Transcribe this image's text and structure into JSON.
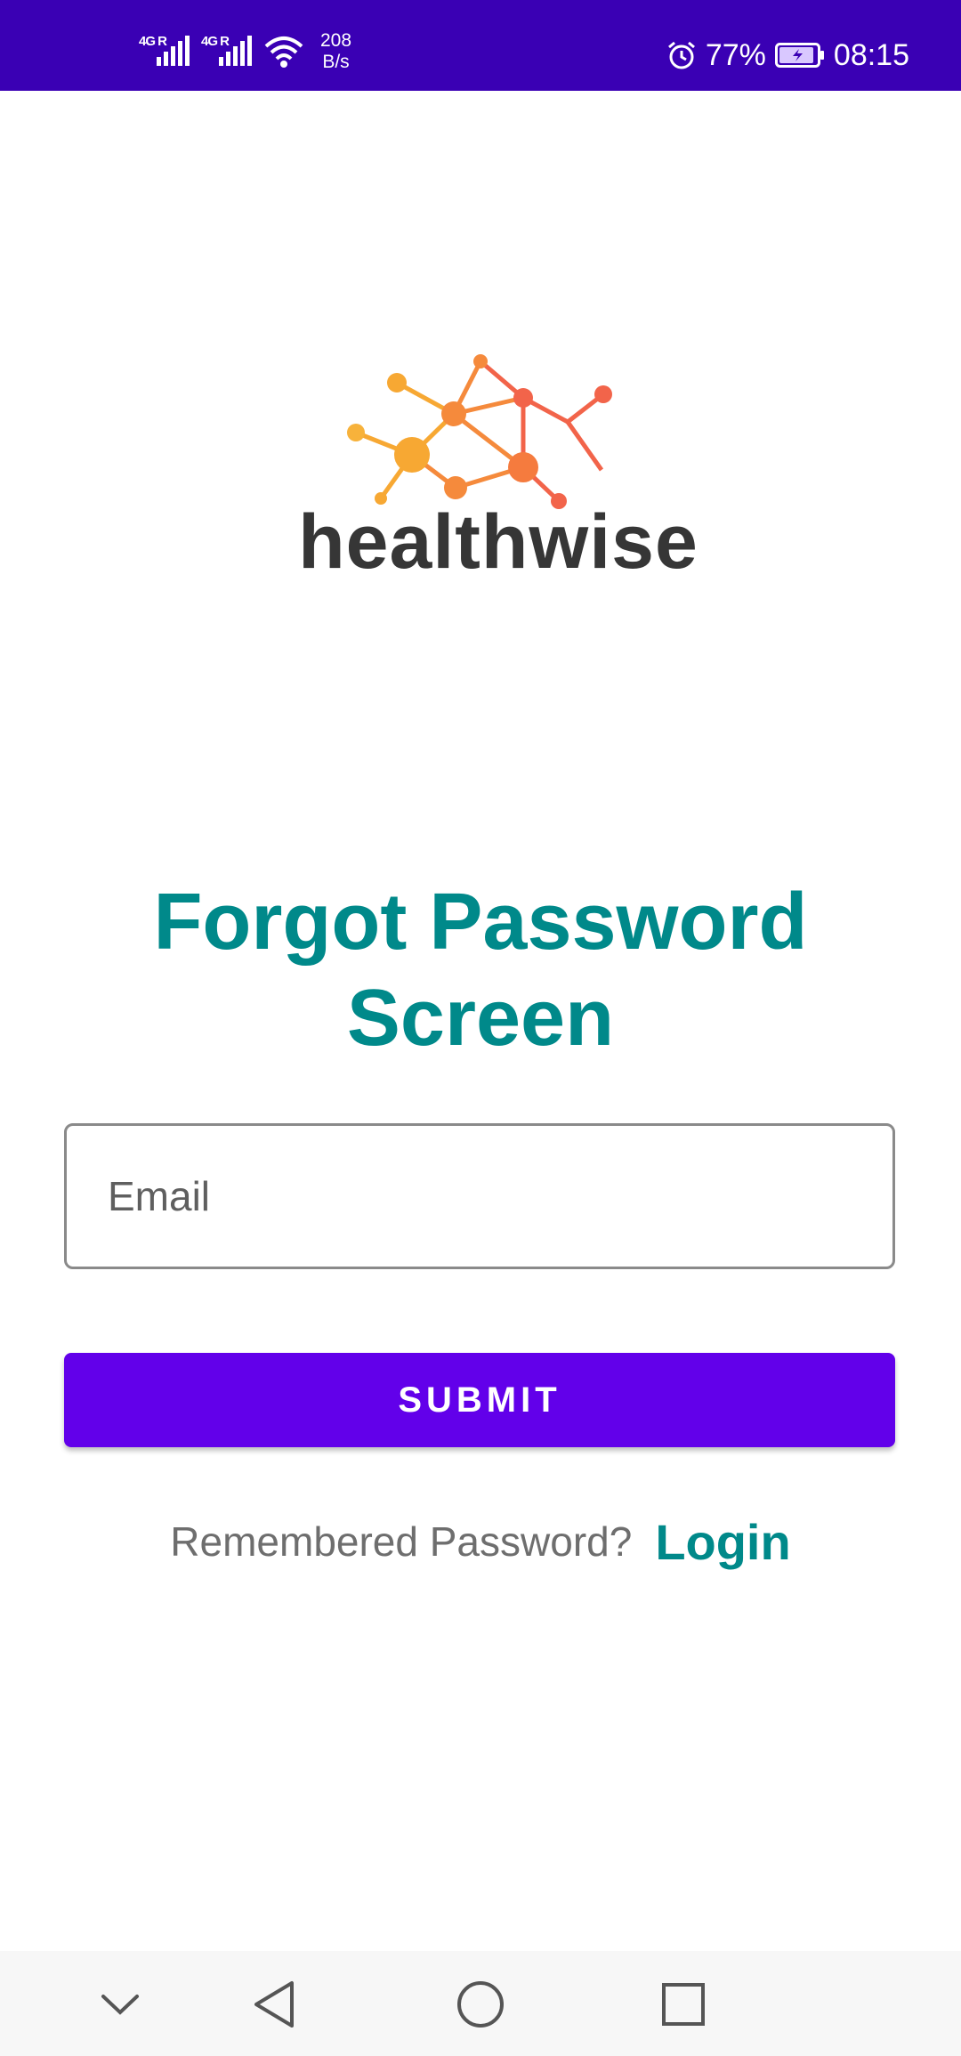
{
  "status_bar": {
    "network_1": "4G R",
    "network_2": "4G R",
    "speed_value": "208",
    "speed_unit": "B/s",
    "battery_percent": "77%",
    "time": "08:15"
  },
  "logo": {
    "wordmark": "healthwise",
    "colors": [
      "#f7a833",
      "#f58a3c",
      "#f2644a"
    ]
  },
  "title": {
    "line1": "Forgot Password",
    "line2": "Screen"
  },
  "form": {
    "email_placeholder": "Email",
    "email_value": "",
    "submit_label": "SUBMIT"
  },
  "footer": {
    "remember_text": "Remembered Password?",
    "login_label": "Login"
  },
  "colors": {
    "status_bar": "#3a00b4",
    "accent_teal": "#00898a",
    "button": "#6200ea"
  },
  "nav_bar": {
    "icons": [
      "chevron-down-icon",
      "back-icon",
      "home-icon",
      "recents-icon"
    ]
  }
}
